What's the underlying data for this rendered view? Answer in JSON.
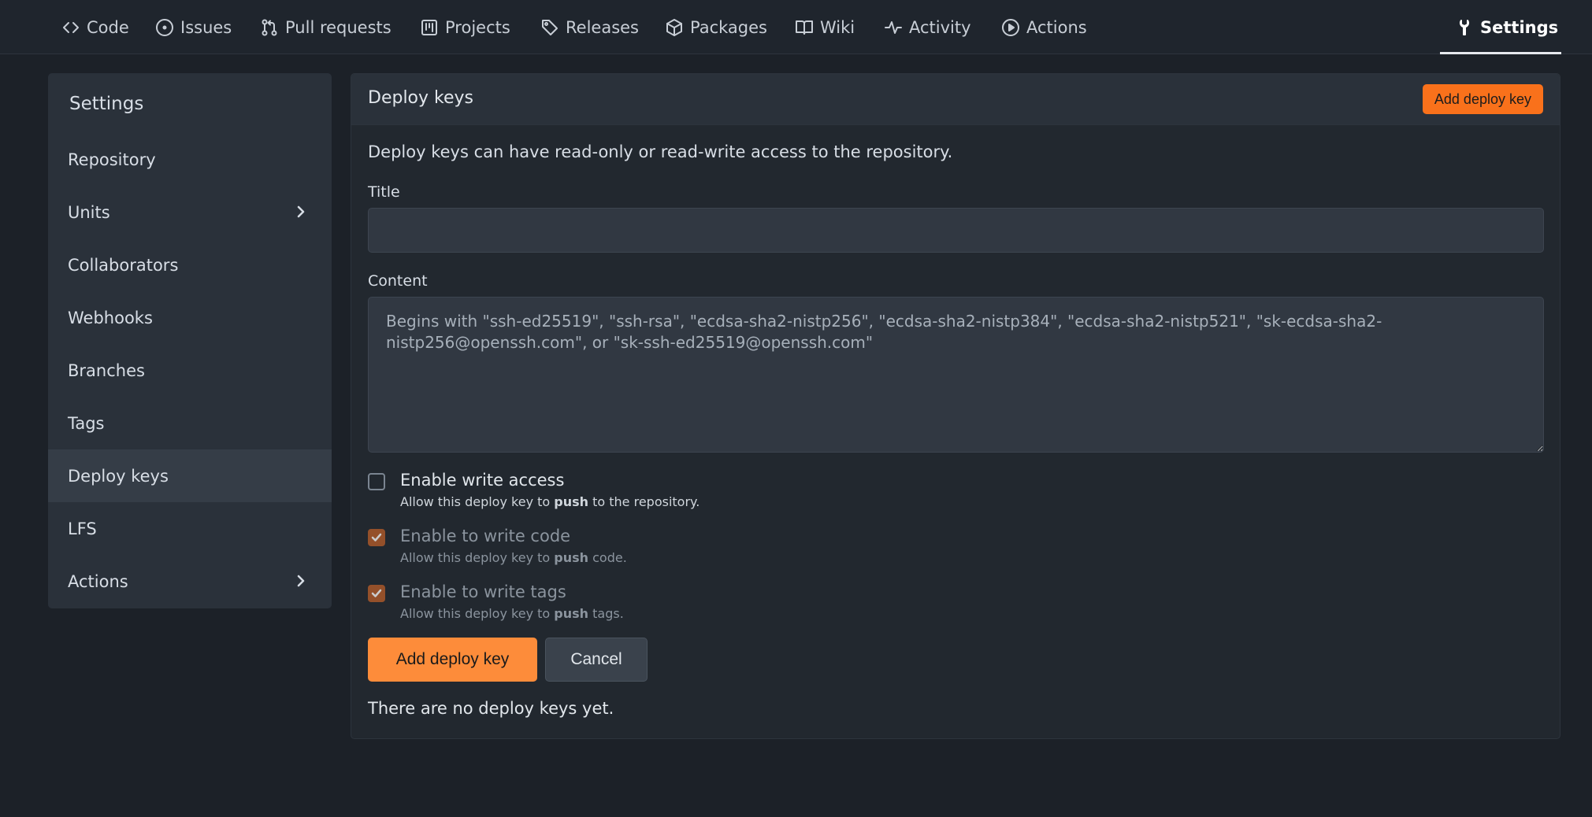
{
  "nav": {
    "tabs": [
      {
        "label": "Code",
        "icon": "code-icon"
      },
      {
        "label": "Issues",
        "icon": "issue-icon"
      },
      {
        "label": "Pull requests",
        "icon": "pull-request-icon"
      },
      {
        "label": "Projects",
        "icon": "project-icon"
      },
      {
        "label": "Releases",
        "icon": "tag-icon"
      },
      {
        "label": "Packages",
        "icon": "package-icon"
      },
      {
        "label": "Wiki",
        "icon": "book-icon"
      },
      {
        "label": "Activity",
        "icon": "pulse-icon"
      },
      {
        "label": "Actions",
        "icon": "play-icon"
      },
      {
        "label": "Settings",
        "icon": "tool-icon",
        "active": true
      }
    ]
  },
  "sidebar": {
    "title": "Settings",
    "items": [
      {
        "label": "Repository"
      },
      {
        "label": "Units",
        "expandable": true
      },
      {
        "label": "Collaborators"
      },
      {
        "label": "Webhooks"
      },
      {
        "label": "Branches"
      },
      {
        "label": "Tags"
      },
      {
        "label": "Deploy keys",
        "active": true
      },
      {
        "label": "LFS"
      },
      {
        "label": "Actions",
        "expandable": true
      }
    ]
  },
  "main": {
    "header_title": "Deploy keys",
    "header_button": "Add deploy key",
    "description": "Deploy keys can have read-only or read-write access to the repository.",
    "title_label": "Title",
    "title_value": "",
    "content_label": "Content",
    "content_placeholder": "Begins with \"ssh-ed25519\", \"ssh-rsa\", \"ecdsa-sha2-nistp256\", \"ecdsa-sha2-nistp384\", \"ecdsa-sha2-nistp521\", \"sk-ecdsa-sha2-nistp256@openssh.com\", or \"sk-ssh-ed25519@openssh.com\"",
    "options": [
      {
        "title": "Enable write access",
        "sub_pre": "Allow this deploy key to ",
        "sub_bold": "push",
        "sub_post": " to the repository.",
        "checked": false,
        "disabled": false
      },
      {
        "title": "Enable to write code",
        "sub_pre": "Allow this deploy key to ",
        "sub_bold": "push",
        "sub_post": " code.",
        "checked": true,
        "disabled": true
      },
      {
        "title": "Enable to write tags",
        "sub_pre": "Allow this deploy key to ",
        "sub_bold": "push",
        "sub_post": " tags.",
        "checked": true,
        "disabled": true
      }
    ],
    "submit_label": "Add deploy key",
    "cancel_label": "Cancel",
    "empty_text": "There are no deploy keys yet."
  },
  "colors": {
    "accent": "#f9711b",
    "primary_button": "#fd8c3a",
    "background": "#1c2128",
    "panel": "#22282f"
  }
}
